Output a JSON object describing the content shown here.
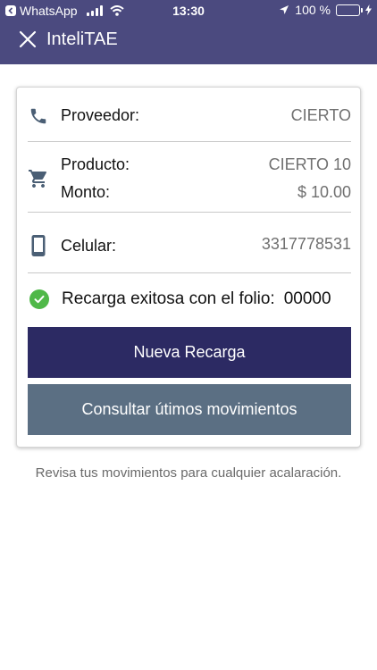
{
  "status_bar": {
    "back_app": "WhatsApp",
    "time": "13:30",
    "battery": "100 %",
    "battery_level": 1.0
  },
  "header": {
    "title": "InteliTAE",
    "close_icon": "close-icon"
  },
  "card": {
    "proveedor": {
      "icon": "phone-icon",
      "label": "Proveedor:",
      "value": "CIERTO"
    },
    "producto": {
      "icon": "cart-icon",
      "label": "Producto:",
      "value": "CIERTO 10"
    },
    "monto": {
      "label": "Monto:",
      "value": "$ 10.00"
    },
    "celular": {
      "icon": "mobile-phone-icon",
      "label": "Celular:",
      "value": "3317778531"
    },
    "success": {
      "icon": "check-circle-icon",
      "message": "Recarga exitosa con el folio:",
      "folio": "00000"
    },
    "buttons": {
      "nueva_recarga": "Nueva Recarga",
      "consultar": "Consultar útimos movimientos"
    }
  },
  "footer_note": "Revisa tus movimientos para cualquier acalaración.",
  "colors": {
    "header_bg": "#4b4a7f",
    "primary_button": "#2c2a63",
    "secondary_button": "#5b6f83",
    "success_green": "#4fb848",
    "icon_color": "#4b5f75"
  }
}
